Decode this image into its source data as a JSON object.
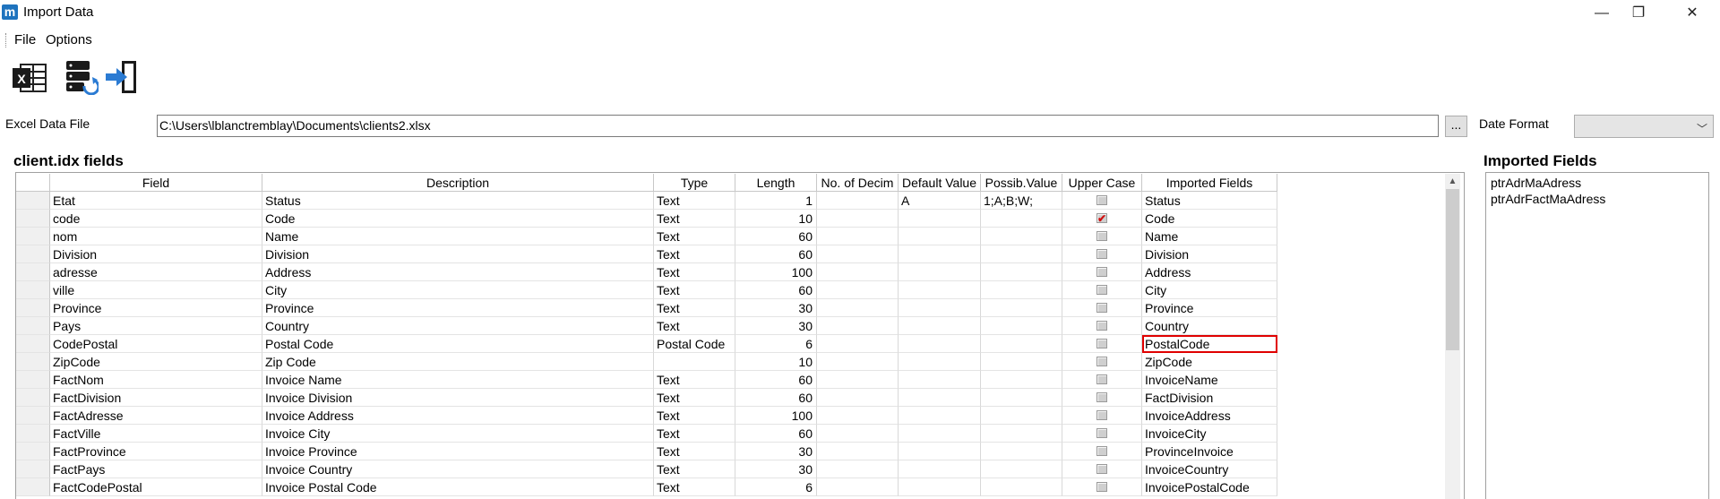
{
  "window": {
    "icon_letter": "m",
    "title": "Import Data",
    "minimize": "—",
    "maximize": "❐",
    "close": "✕"
  },
  "menu": {
    "items": [
      "File",
      "Options"
    ]
  },
  "toolbar": {
    "icons": [
      "excel-icon",
      "database-sync-icon",
      "import-exit-icon"
    ]
  },
  "file_row": {
    "excel_label": "Excel Data File",
    "path": "C:\\Users\\lblanctremblay\\Documents\\clients2.xlsx",
    "browse_label": "...",
    "date_format_label": "Date Format",
    "date_format_value": ""
  },
  "fields_group": {
    "title": "client.idx fields"
  },
  "grid": {
    "columns": [
      "Field",
      "Description",
      "Type",
      "Length",
      "No. of Decim",
      "Default Value",
      "Possib.Value",
      "Upper Case",
      "Imported Fields"
    ],
    "rows": [
      {
        "field": "Etat",
        "desc": "Status",
        "type": "Text",
        "length": "1",
        "decim": "",
        "default": "A",
        "possib": "1;A;B;W;",
        "upper": false,
        "imported": "Status"
      },
      {
        "field": "code",
        "desc": "Code",
        "type": "Text",
        "length": "10",
        "decim": "",
        "default": "",
        "possib": "",
        "upper": true,
        "imported": "Code"
      },
      {
        "field": "nom",
        "desc": "Name",
        "type": "Text",
        "length": "60",
        "decim": "",
        "default": "",
        "possib": "",
        "upper": false,
        "imported": "Name"
      },
      {
        "field": "Division",
        "desc": "Division",
        "type": "Text",
        "length": "60",
        "decim": "",
        "default": "",
        "possib": "",
        "upper": false,
        "imported": "Division"
      },
      {
        "field": "adresse",
        "desc": "Address",
        "type": "Text",
        "length": "100",
        "decim": "",
        "default": "",
        "possib": "",
        "upper": false,
        "imported": "Address"
      },
      {
        "field": "ville",
        "desc": "City",
        "type": "Text",
        "length": "60",
        "decim": "",
        "default": "",
        "possib": "",
        "upper": false,
        "imported": "City"
      },
      {
        "field": "Province",
        "desc": "Province",
        "type": "Text",
        "length": "30",
        "decim": "",
        "default": "",
        "possib": "",
        "upper": false,
        "imported": "Province"
      },
      {
        "field": "Pays",
        "desc": "Country",
        "type": "Text",
        "length": "30",
        "decim": "",
        "default": "",
        "possib": "",
        "upper": false,
        "imported": "Country"
      },
      {
        "field": "CodePostal",
        "desc": "Postal Code",
        "type": "Postal Code",
        "length": "6",
        "decim": "",
        "default": "",
        "possib": "",
        "upper": false,
        "imported": "PostalCode",
        "highlight": true
      },
      {
        "field": "ZipCode",
        "desc": "Zip Code",
        "type": "",
        "length": "10",
        "decim": "",
        "default": "",
        "possib": "",
        "upper": false,
        "imported": "ZipCode"
      },
      {
        "field": "FactNom",
        "desc": "Invoice Name",
        "type": "Text",
        "length": "60",
        "decim": "",
        "default": "",
        "possib": "",
        "upper": false,
        "imported": "InvoiceName"
      },
      {
        "field": "FactDivision",
        "desc": "Invoice Division",
        "type": "Text",
        "length": "60",
        "decim": "",
        "default": "",
        "possib": "",
        "upper": false,
        "imported": "FactDivision"
      },
      {
        "field": "FactAdresse",
        "desc": "Invoice Address",
        "type": "Text",
        "length": "100",
        "decim": "",
        "default": "",
        "possib": "",
        "upper": false,
        "imported": "InvoiceAddress"
      },
      {
        "field": "FactVille",
        "desc": "Invoice City",
        "type": "Text",
        "length": "60",
        "decim": "",
        "default": "",
        "possib": "",
        "upper": false,
        "imported": "InvoiceCity"
      },
      {
        "field": "FactProvince",
        "desc": "Invoice Province",
        "type": "Text",
        "length": "30",
        "decim": "",
        "default": "",
        "possib": "",
        "upper": false,
        "imported": "ProvinceInvoice"
      },
      {
        "field": "FactPays",
        "desc": "Invoice Country",
        "type": "Text",
        "length": "30",
        "decim": "",
        "default": "",
        "possib": "",
        "upper": false,
        "imported": "InvoiceCountry"
      },
      {
        "field": "FactCodePostal",
        "desc": "Invoice Postal Code",
        "type": "Text",
        "length": "6",
        "decim": "",
        "default": "",
        "possib": "",
        "upper": false,
        "imported": "InvoicePostalCode"
      }
    ]
  },
  "imported_group": {
    "title": "Imported Fields",
    "items": [
      "ptrAdrMaAdress",
      "ptrAdrFactMaAdress"
    ]
  }
}
